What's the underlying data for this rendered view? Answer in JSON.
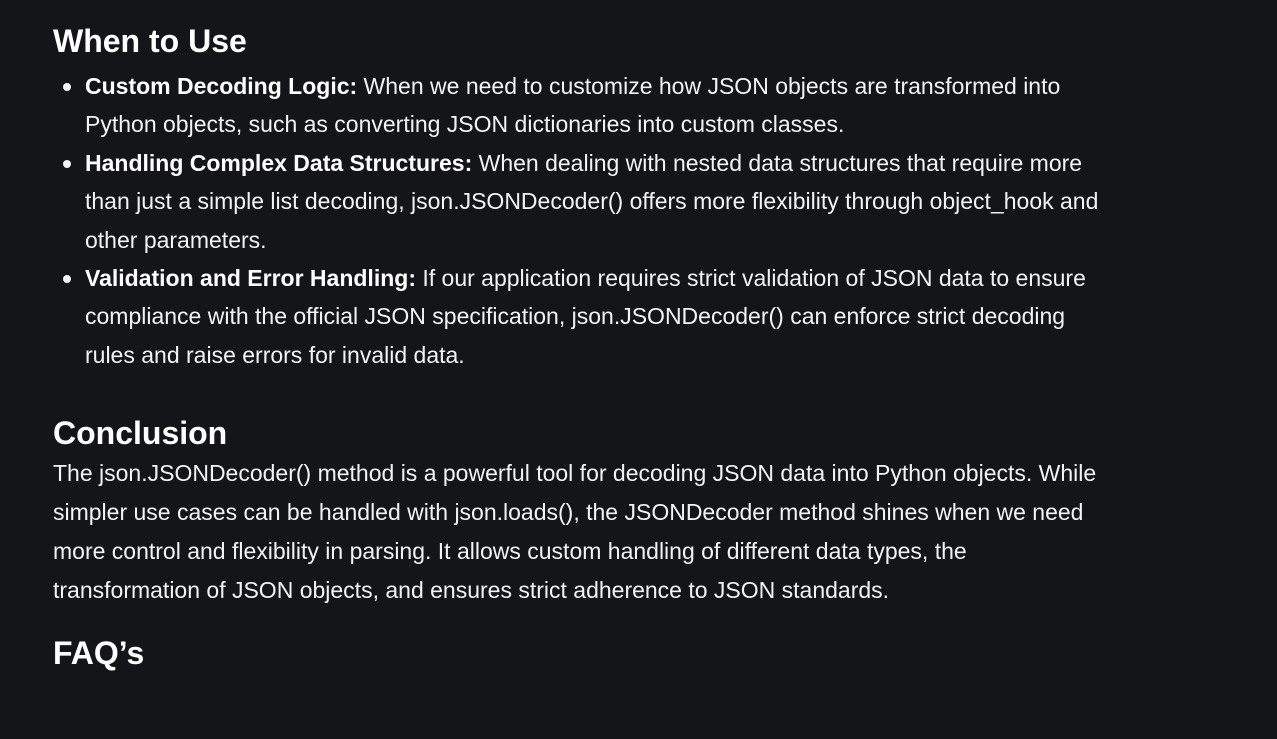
{
  "sections": {
    "when_to_use": {
      "heading": "When to Use",
      "items": [
        {
          "term": "Custom Decoding Logic:",
          "text": " When we need to customize how JSON objects are transformed into Python objects, such as converting JSON dictionaries into custom classes."
        },
        {
          "term": "Handling Complex Data Structures:",
          "text": " When dealing with nested data structures that require more than just a simple list decoding, json.JSONDecoder() offers more flexibility through object_hook and other parameters."
        },
        {
          "term": "Validation and Error Handling:",
          "text": " If our application requires strict validation of JSON data to ensure compliance with the official JSON specification, json.JSONDecoder() can enforce strict decoding rules and raise errors for invalid data."
        }
      ]
    },
    "conclusion": {
      "heading": "Conclusion",
      "paragraph": "The json.JSONDecoder() method is a powerful tool for decoding JSON data into Python objects. While simpler use cases can be handled with json.loads(), the JSONDecoder method shines when we need more control and flexibility in parsing. It allows custom handling of different data types, the transformation of JSON objects, and ensures strict adherence to JSON standards."
    },
    "faq": {
      "heading": "FAQ’s"
    }
  }
}
